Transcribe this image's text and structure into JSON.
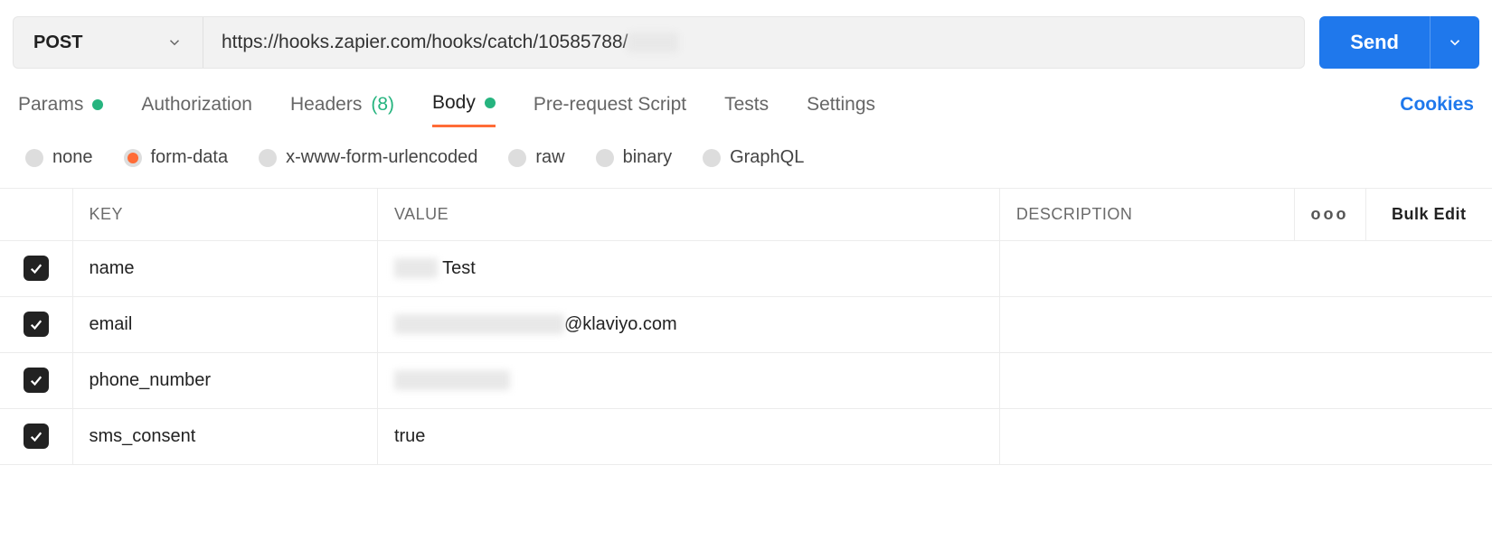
{
  "request": {
    "method": "POST",
    "url": "https://hooks.zapier.com/hooks/catch/10585788/",
    "url_redacted": "xxxxx",
    "send_label": "Send"
  },
  "tabs": {
    "params": "Params",
    "authorization": "Authorization",
    "headers_label": "Headers",
    "headers_count": "(8)",
    "body": "Body",
    "prerequest": "Pre-request Script",
    "tests": "Tests",
    "settings": "Settings",
    "cookies": "Cookies"
  },
  "body_types": {
    "none": "none",
    "formdata": "form-data",
    "urlencoded": "x-www-form-urlencoded",
    "raw": "raw",
    "binary": "binary",
    "graphql": "GraphQL"
  },
  "table": {
    "headers": {
      "key": "KEY",
      "value": "VALUE",
      "description": "DESCRIPTION",
      "bulk": "Bulk Edit"
    },
    "rows": [
      {
        "key": "name",
        "value_prefix_hidden": "xxxx",
        "value_suffix": " Test"
      },
      {
        "key": "email",
        "value_prefix_hidden": "xxxxxxxxxxxxxxxxxx",
        "value_suffix": "@klaviyo.com"
      },
      {
        "key": "phone_number",
        "value_prefix_hidden": "xxxxxxxxxxxx",
        "value_suffix": ""
      },
      {
        "key": "sms_consent",
        "value_prefix_hidden": "",
        "value_suffix": "true"
      }
    ]
  }
}
